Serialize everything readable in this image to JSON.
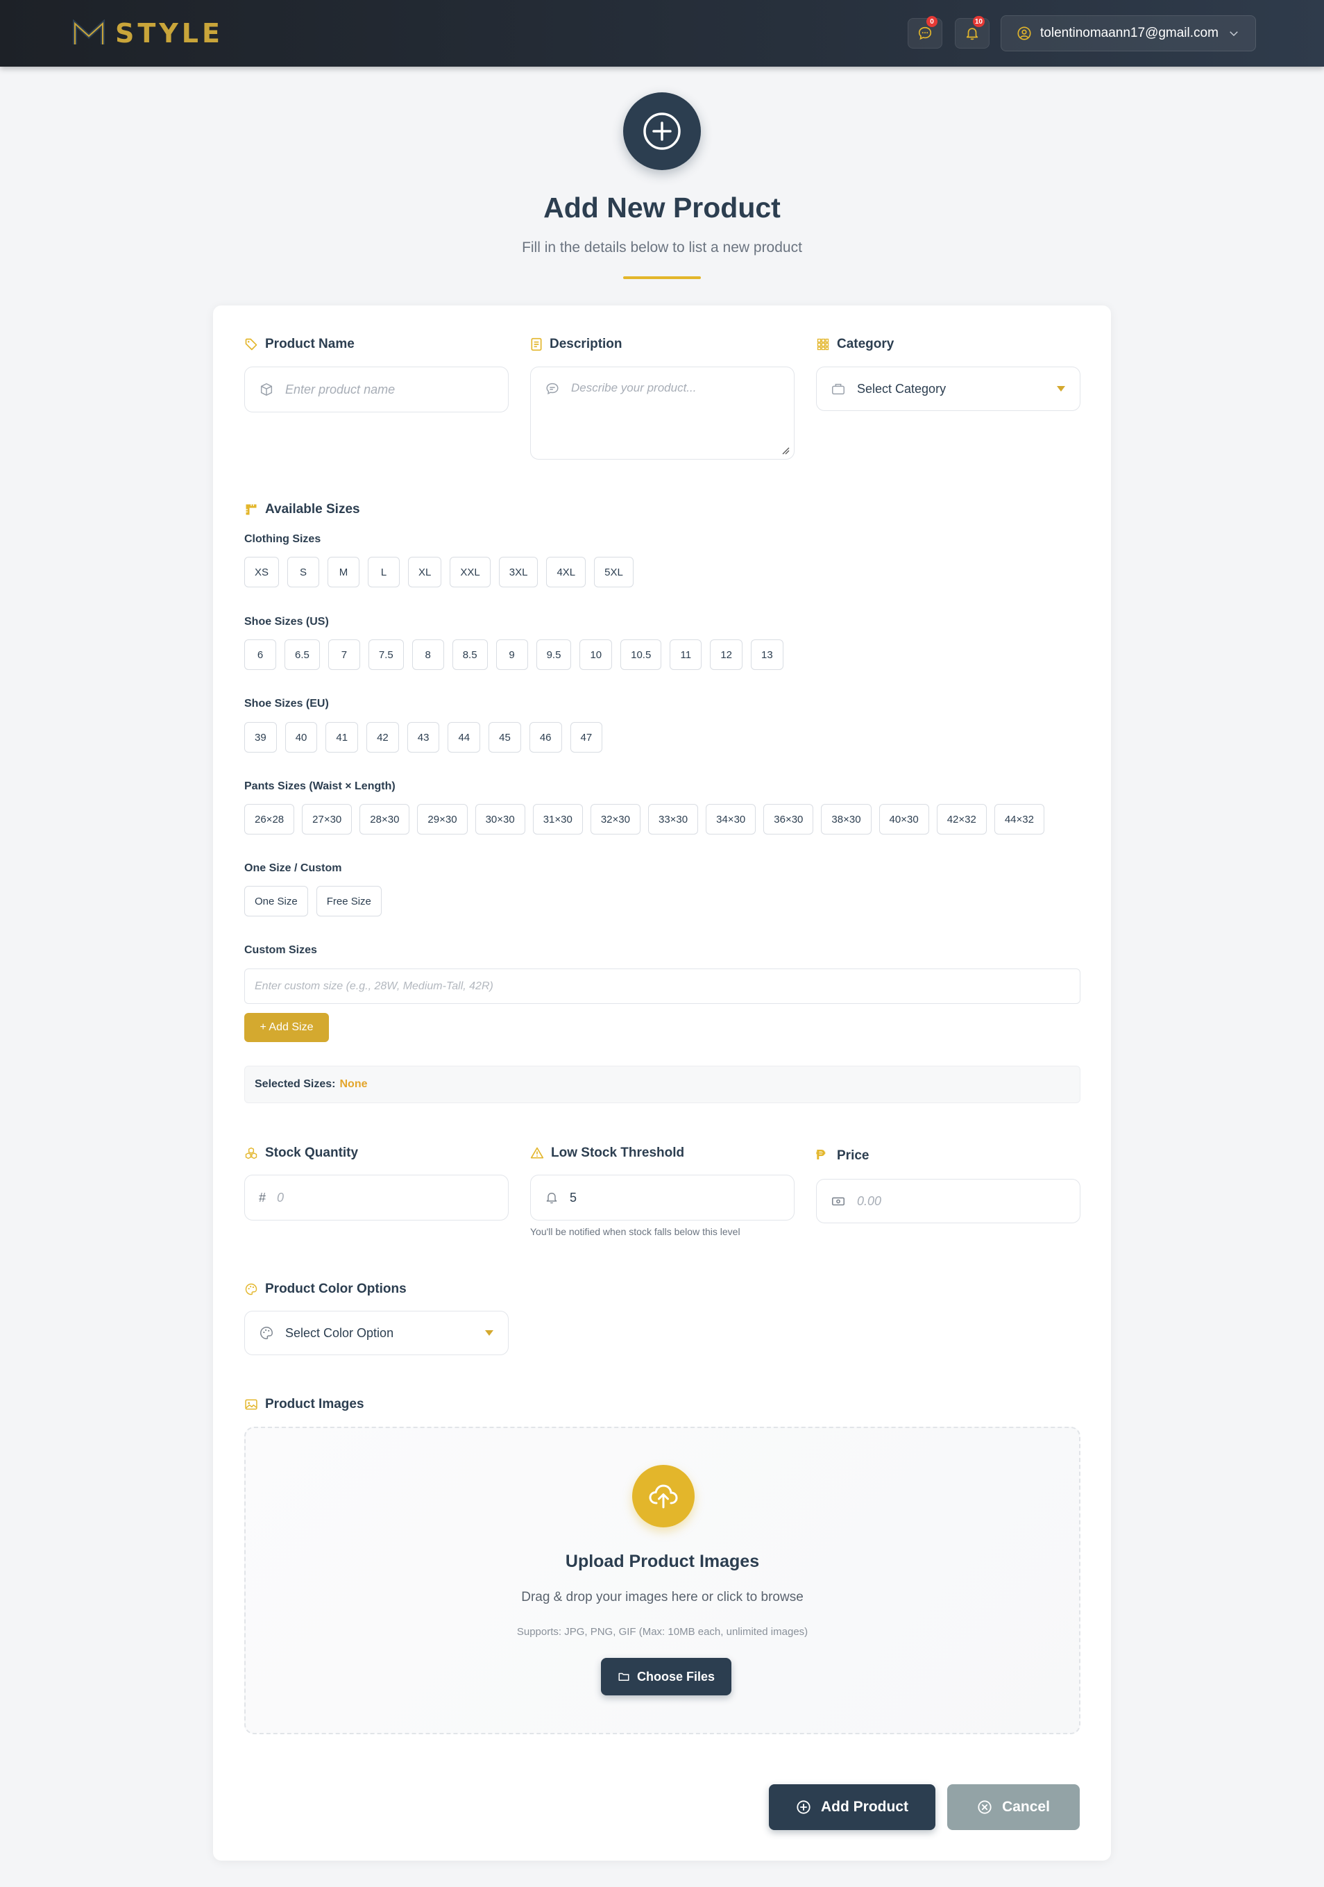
{
  "header": {
    "brand": "STYLE",
    "messages_badge": "0",
    "notifications_badge": "10",
    "user_email": "tolentinomaann17@gmail.com"
  },
  "hero": {
    "title": "Add New Product",
    "subtitle": "Fill in the details below to list a new product"
  },
  "form": {
    "product_name": {
      "label": "Product Name",
      "placeholder": "Enter product name"
    },
    "description": {
      "label": "Description",
      "placeholder": "Describe your product..."
    },
    "category": {
      "label": "Category",
      "selected": "Select Category"
    },
    "sizes": {
      "label": "Available Sizes",
      "clothing": {
        "label": "Clothing Sizes",
        "options": [
          "XS",
          "S",
          "M",
          "L",
          "XL",
          "XXL",
          "3XL",
          "4XL",
          "5XL"
        ]
      },
      "shoe_us": {
        "label": "Shoe Sizes (US)",
        "options": [
          "6",
          "6.5",
          "7",
          "7.5",
          "8",
          "8.5",
          "9",
          "9.5",
          "10",
          "10.5",
          "11",
          "12",
          "13"
        ]
      },
      "shoe_eu": {
        "label": "Shoe Sizes (EU)",
        "options": [
          "39",
          "40",
          "41",
          "42",
          "43",
          "44",
          "45",
          "46",
          "47"
        ]
      },
      "pants": {
        "label": "Pants Sizes (Waist × Length)",
        "options": [
          "26×28",
          "27×30",
          "28×30",
          "29×30",
          "30×30",
          "31×30",
          "32×30",
          "33×30",
          "34×30",
          "36×30",
          "38×30",
          "40×30",
          "42×32",
          "44×32"
        ]
      },
      "one_size": {
        "label": "One Size / Custom",
        "options": [
          "One Size",
          "Free Size"
        ]
      },
      "custom": {
        "label": "Custom Sizes",
        "placeholder": "Enter custom size (e.g., 28W, Medium-Tall, 42R)",
        "add_button": "+ Add Size"
      },
      "selected_label": "Selected Sizes:",
      "selected_value": "None"
    },
    "stock_quantity": {
      "label": "Stock Quantity",
      "prefix": "#",
      "placeholder": "0"
    },
    "low_stock": {
      "label": "Low Stock Threshold",
      "value": "5",
      "hint": "You'll be notified when stock falls below this level"
    },
    "price": {
      "label": "Price",
      "symbol": "₱",
      "placeholder": "0.00"
    },
    "color": {
      "label": "Product Color Options",
      "selected": "Select Color Option"
    },
    "images": {
      "label": "Product Images",
      "upload_title": "Upload Product Images",
      "upload_text": "Drag & drop your images here or click to browse",
      "upload_hint": "Supports: JPG, PNG, GIF (Max: 10MB each, unlimited images)",
      "choose_button": "Choose Files"
    },
    "actions": {
      "submit": "Add Product",
      "cancel": "Cancel"
    }
  },
  "colors": {
    "navy": "#2c3e50",
    "gold": "#e3b62b",
    "cancel_gray": "#93a3a6"
  }
}
